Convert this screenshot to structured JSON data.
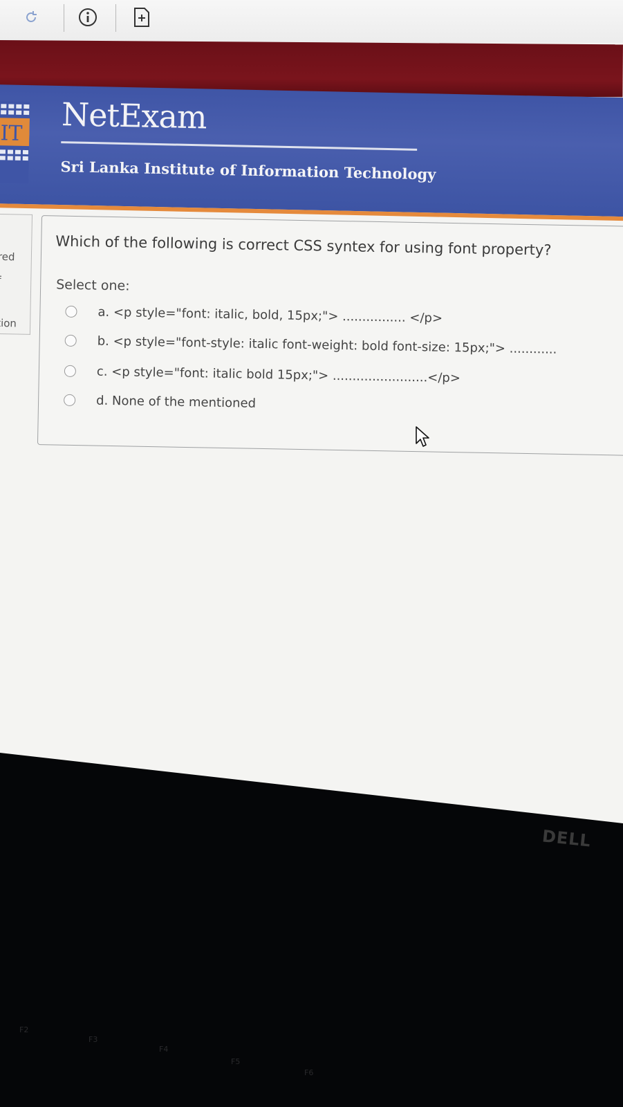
{
  "header": {
    "brand": "NetExam",
    "institute": "Sri Lanka Institute of Information Technology",
    "logo_text": "IT"
  },
  "sidebar": {
    "fragments": [
      "red",
      "f",
      "tion"
    ]
  },
  "quiz": {
    "question": "Which of the following is correct CSS syntex for using font property?",
    "select_label": "Select one:",
    "options": [
      {
        "label": "a. <p style=\"font: italic, bold, 15px;\"> ................ </p>"
      },
      {
        "label": "b. <p style=\"font-style: italic font-weight: bold font-size: 15px;\"> ............"
      },
      {
        "label": "c. <p style=\"font: italic bold 15px;\"> ........................</p>"
      },
      {
        "label": "d. None of the mentioned"
      }
    ]
  },
  "device": {
    "brand": "DELL",
    "keys": [
      "F2",
      "F3",
      "F4",
      "F5",
      "F6"
    ]
  },
  "colors": {
    "banner_blue": "#4a5fae",
    "maroon": "#7a141c",
    "accent_orange": "#e58a3c"
  }
}
